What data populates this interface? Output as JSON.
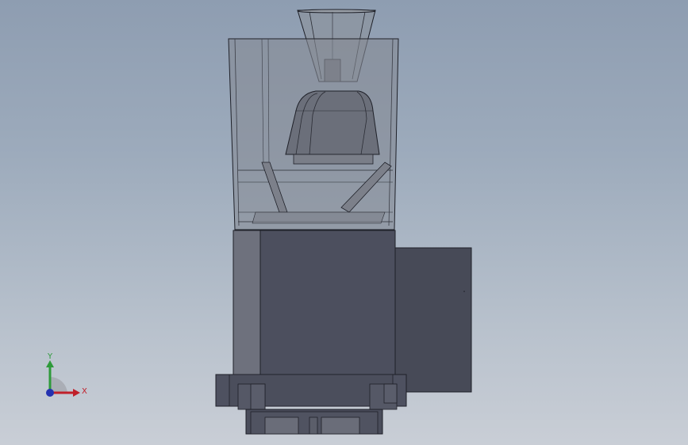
{
  "viewport": {
    "background_top": "#8e9db1",
    "background_bottom": "#c9ced6"
  },
  "triad": {
    "x_label": "X",
    "y_label": "Y",
    "x_color": "#c0202a",
    "y_color": "#2e9a3a",
    "z_color": "#2432b0"
  },
  "model": {
    "housing_glass_color": "#8a8f98",
    "motor_body_color": "#4c4f5e",
    "side_box_color": "#474a57",
    "edge_color": "#1e2028"
  }
}
